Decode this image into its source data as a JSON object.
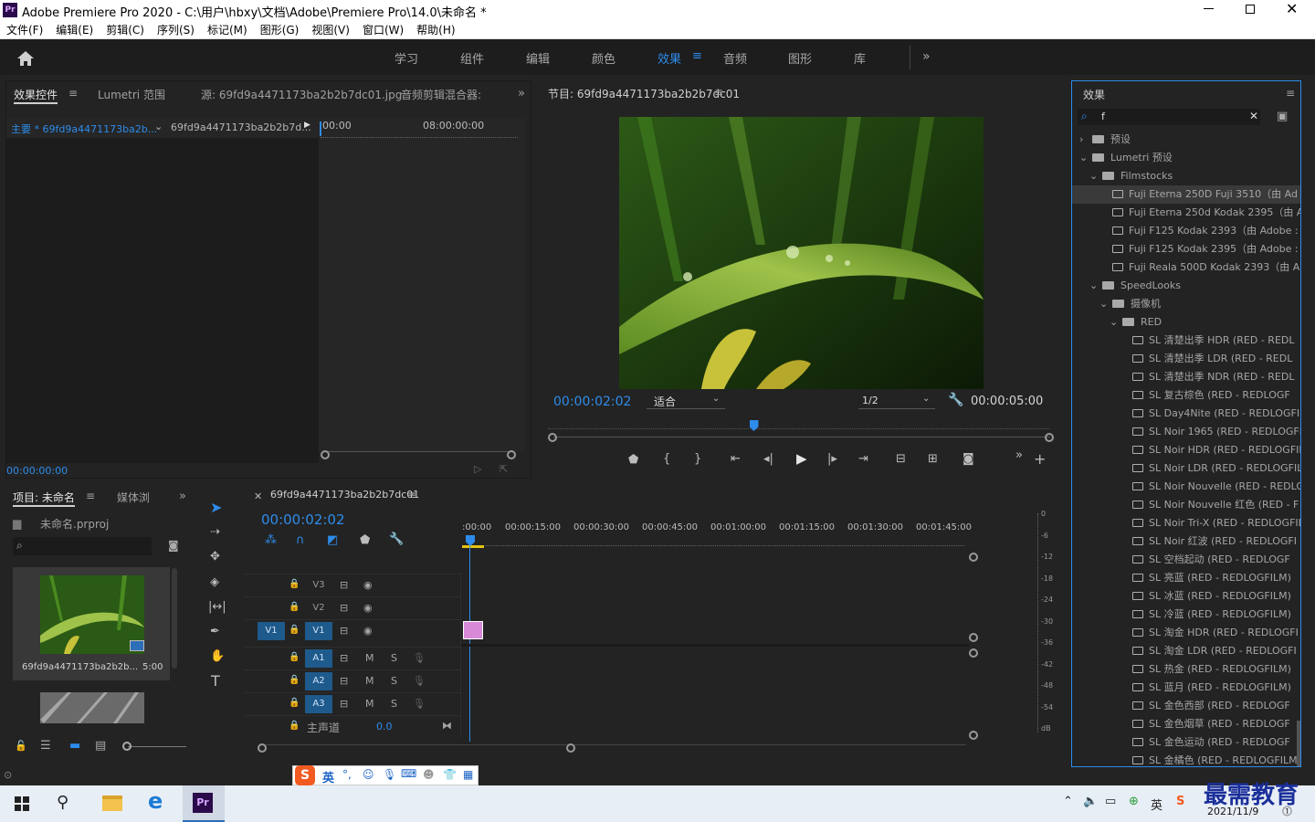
{
  "window": {
    "title": "Adobe Premiere Pro 2020 - C:\\用户\\hbxy\\文档\\Adobe\\Premiere Pro\\14.0\\未命名 *",
    "app_icon": "Pr"
  },
  "menu": [
    "文件(F)",
    "编辑(E)",
    "剪辑(C)",
    "序列(S)",
    "标记(M)",
    "图形(G)",
    "视图(V)",
    "窗口(W)",
    "帮助(H)"
  ],
  "workspaces": {
    "items": [
      "学习",
      "组件",
      "编辑",
      "颜色",
      "效果",
      "音频",
      "图形",
      "库"
    ],
    "active": "效果"
  },
  "source_panel": {
    "tabs": [
      "效果控件",
      "Lumetri 范围",
      "源: 69fd9a4471173ba2b2b7dc01.jpg",
      "音频剪辑混合器: "
    ],
    "master_label": "主要 * 69fd9a4471173ba2b...",
    "clip_label": "69fd9a4471173ba2b2b7d...",
    "ruler": [
      "00:00",
      "08:00:00:00"
    ],
    "timecode": "00:00:00:00"
  },
  "program_monitor": {
    "title": "节目: 69fd9a4471173ba2b2b7dc01",
    "timecode": "00:00:02:02",
    "fit": "适合",
    "resolution": "1/2",
    "duration": "00:00:05:00",
    "playhead_fraction": 0.41
  },
  "project_panel": {
    "tabs": [
      "项目: 未命名",
      "媒体浏"
    ],
    "file": "未命名.prproj",
    "clip_name": "69fd9a4471173ba2b2b...",
    "clip_duration": "5:00"
  },
  "timeline": {
    "sequence": "69fd9a4471173ba2b2b7dc01",
    "timecode": "00:00:02:02",
    "ruler": [
      ":00:00",
      "00:00:15:00",
      "00:00:30:00",
      "00:00:45:00",
      "00:01:00:00",
      "00:01:15:00",
      "00:01:30:00",
      "00:01:45:00"
    ],
    "video_tracks": [
      "V3",
      "V2",
      "V1"
    ],
    "audio_tracks": [
      "A1",
      "A2",
      "A3"
    ],
    "source_patch": "V1",
    "mute_label": "M",
    "solo_label": "S",
    "master": "主声道",
    "master_value": "0.0"
  },
  "meter": {
    "scale": [
      "0",
      "-6",
      "-12",
      "-18",
      "-24",
      "-30",
      "-36",
      "-42",
      "-48",
      "-54",
      "dB"
    ]
  },
  "effects_panel": {
    "title": "效果",
    "search": "f",
    "tree": [
      {
        "label": "预设",
        "level": 0,
        "type": "folder",
        "expanded": false
      },
      {
        "label": "Lumetri 预设",
        "level": 0,
        "type": "folder",
        "expanded": true
      },
      {
        "label": "Filmstocks",
        "level": 1,
        "type": "folder",
        "expanded": true
      },
      {
        "label": "Fuji Eterna 250D Fuji 3510（由 Ad",
        "level": 2,
        "type": "preset",
        "selected": true
      },
      {
        "label": "Fuji Eterna 250d Kodak 2395（由 A",
        "level": 2,
        "type": "preset"
      },
      {
        "label": "Fuji F125 Kodak 2393（由 Adobe :",
        "level": 2,
        "type": "preset"
      },
      {
        "label": "Fuji F125 Kodak 2395（由 Adobe :",
        "level": 2,
        "type": "preset"
      },
      {
        "label": "Fuji Reala 500D Kodak 2393（由 A",
        "level": 2,
        "type": "preset"
      },
      {
        "label": "SpeedLooks",
        "level": 1,
        "type": "folder",
        "expanded": true
      },
      {
        "label": "摄像机",
        "level": 2,
        "type": "folder",
        "expanded": true
      },
      {
        "label": "RED",
        "level": 3,
        "type": "folder",
        "expanded": true
      },
      {
        "label": "SL 清楚出季 HDR (RED - REDL",
        "level": 4,
        "type": "preset"
      },
      {
        "label": "SL 清楚出季 LDR (RED - REDL",
        "level": 4,
        "type": "preset"
      },
      {
        "label": "SL 清楚出季 NDR (RED - REDL",
        "level": 4,
        "type": "preset"
      },
      {
        "label": "SL 复古棕色 (RED - REDLOGF",
        "level": 4,
        "type": "preset"
      },
      {
        "label": "SL Day4Nite (RED - REDLOGFIL",
        "level": 4,
        "type": "preset"
      },
      {
        "label": "SL Noir 1965 (RED - REDLOGFIL",
        "level": 4,
        "type": "preset"
      },
      {
        "label": "SL Noir HDR (RED - REDLOGFIL",
        "level": 4,
        "type": "preset"
      },
      {
        "label": "SL Noir LDR (RED - REDLOGFIL",
        "level": 4,
        "type": "preset"
      },
      {
        "label": "SL Noir Nouvelle (RED - REDLO",
        "level": 4,
        "type": "preset"
      },
      {
        "label": "SL Noir Nouvelle 红色 (RED - F",
        "level": 4,
        "type": "preset"
      },
      {
        "label": "SL Noir Tri-X (RED - REDLOGFIL",
        "level": 4,
        "type": "preset"
      },
      {
        "label": "SL Noir 红波 (RED - REDLOGFI",
        "level": 4,
        "type": "preset"
      },
      {
        "label": "SL 空档起动 (RED - REDLOGF",
        "level": 4,
        "type": "preset"
      },
      {
        "label": "SL 亮蓝 (RED - REDLOGFILM)",
        "level": 4,
        "type": "preset"
      },
      {
        "label": "SL 冰蓝 (RED - REDLOGFILM)",
        "level": 4,
        "type": "preset"
      },
      {
        "label": "SL 冷蓝 (RED - REDLOGFILM)",
        "level": 4,
        "type": "preset"
      },
      {
        "label": "SL 淘金 HDR (RED - REDLOGFI",
        "level": 4,
        "type": "preset"
      },
      {
        "label": "SL 淘金 LDR (RED - REDLOGFI",
        "level": 4,
        "type": "preset"
      },
      {
        "label": "SL 热金 (RED - REDLOGFILM)",
        "level": 4,
        "type": "preset"
      },
      {
        "label": "SL 蓝月 (RED - REDLOGFILM)",
        "level": 4,
        "type": "preset"
      },
      {
        "label": "SL 金色西部 (RED - REDLOGF",
        "level": 4,
        "type": "preset"
      },
      {
        "label": "SL 金色烟草 (RED - REDLOGF",
        "level": 4,
        "type": "preset"
      },
      {
        "label": "SL 金色运动 (RED - REDLOGF",
        "level": 4,
        "type": "preset"
      },
      {
        "label": "SL 金橘色 (RED - REDLOGFILM",
        "level": 4,
        "type": "preset"
      }
    ]
  },
  "ime": {
    "lang": "英"
  },
  "taskbar": {
    "date": "2021/11/9",
    "tray_ime": "英",
    "watermark": "最需教育"
  },
  "colors": {
    "accent": "#2d8ceb",
    "panel": "#232323",
    "clip": "#d88ad8"
  }
}
